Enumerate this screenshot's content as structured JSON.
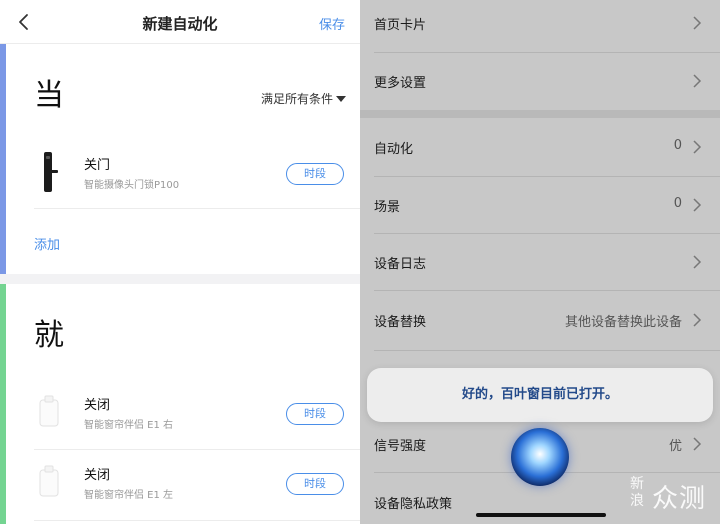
{
  "left": {
    "nav": {
      "title": "新建自动化",
      "save_label": "保存"
    },
    "when": {
      "heading": "当",
      "condition_filter": "满足所有条件",
      "devices": [
        {
          "title": "关门",
          "subtitle": "智能摄像头门锁P100",
          "button": "时段",
          "icon": "door-lock-icon"
        }
      ],
      "add_label": "添加"
    },
    "then": {
      "heading": "就",
      "devices": [
        {
          "title": "关闭",
          "subtitle": "智能窗帘伴侣 E1 右",
          "button": "时段",
          "icon": "curtain-motor-icon"
        },
        {
          "title": "关闭",
          "subtitle": "智能窗帘伴侣 E1 左",
          "button": "时段",
          "icon": "curtain-motor-icon"
        }
      ]
    },
    "colors": {
      "accent_when": "#7b98e6",
      "accent_then": "#74d491",
      "link": "#4a8ee8"
    }
  },
  "right": {
    "rows": [
      {
        "label": "首页卡片",
        "value": ""
      },
      {
        "label": "更多设置",
        "value": ""
      },
      {
        "label": "自动化",
        "value": "0"
      },
      {
        "label": "场景",
        "value": "0"
      },
      {
        "label": "设备日志",
        "value": ""
      },
      {
        "label": "设备替换",
        "value": "其他设备替换此设备"
      },
      {
        "label": "信号强度",
        "value": "优"
      },
      {
        "label": "设备隐私政策",
        "value": ""
      }
    ],
    "siri_message": "好的，百叶窗目前已打开。",
    "watermark": {
      "small": "新浪",
      "big": "众测"
    }
  }
}
